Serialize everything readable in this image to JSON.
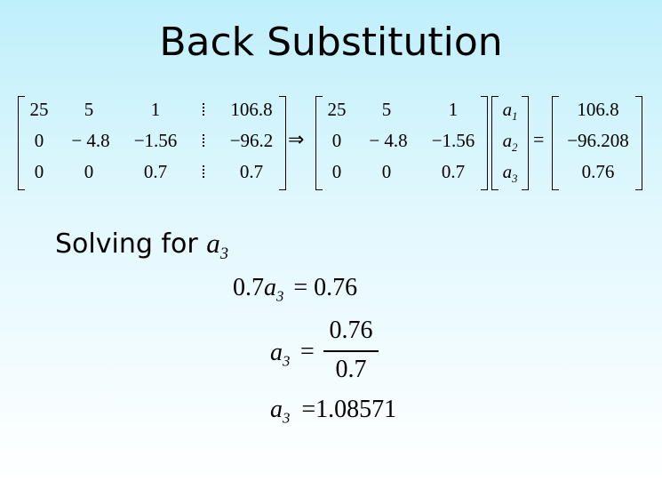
{
  "title": "Back Substitution",
  "augmented": {
    "rows": [
      [
        "25",
        "5",
        "1",
        "106.8"
      ],
      [
        "0",
        "− 4.8",
        "−1.56",
        "−96.2"
      ],
      [
        "0",
        "0",
        "0.7",
        "0.7"
      ]
    ]
  },
  "coef": {
    "rows": [
      [
        "25",
        "5",
        "1"
      ],
      [
        "0",
        "− 4.8",
        "−1.56"
      ],
      [
        "0",
        "0",
        "0.7"
      ]
    ]
  },
  "unknowns": {
    "var": "a",
    "subs": [
      "1",
      "2",
      "3"
    ]
  },
  "rhs": [
    "106.8",
    "−96.208",
    "0.76"
  ],
  "symbols": {
    "implies": "⇒",
    "equals": "="
  },
  "solving": {
    "label": "Solving for",
    "var": "a",
    "sub": "3"
  },
  "equations": {
    "eq1_coef": "0.7",
    "eq1_var": "a",
    "eq1_sub": "3",
    "eq1_rhs": "= 0.76",
    "eq2_var": "a",
    "eq2_sub": "3",
    "eq2_eq": "=",
    "eq2_num": "0.76",
    "eq2_den": "0.7",
    "eq3_var": "a",
    "eq3_sub": "3",
    "eq3_rhs": "=1.08571"
  }
}
